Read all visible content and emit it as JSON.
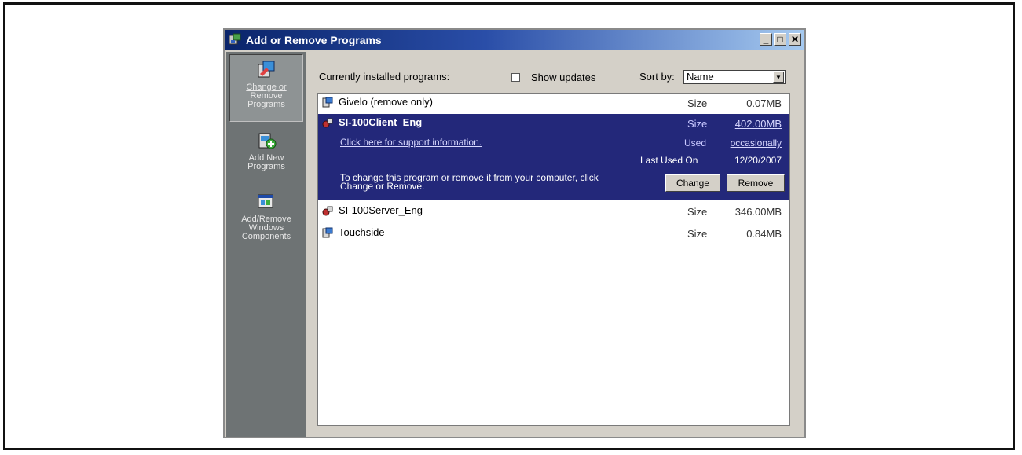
{
  "window": {
    "title": "Add or Remove Programs",
    "controls": {
      "minimize": "_",
      "maximize": "□",
      "close": "✕"
    }
  },
  "sidebar": {
    "items": [
      {
        "lines": [
          "Change or",
          "Remove",
          "Programs"
        ],
        "icon": "change-remove-icon",
        "active": true
      },
      {
        "lines": [
          "Add New",
          "Programs"
        ],
        "icon": "add-programs-icon",
        "active": false
      },
      {
        "lines": [
          "Add/Remove",
          "Windows",
          "Components"
        ],
        "icon": "windows-components-icon",
        "active": false
      }
    ]
  },
  "toolbar": {
    "installed_label": "Currently installed programs:",
    "show_updates_label": "Show updates",
    "show_updates_checked": false,
    "sort_label": "Sort by:",
    "sort_value": "Name"
  },
  "programs": [
    {
      "name": "Givelo (remove only)",
      "size_label": "Size",
      "size": "0.07MB",
      "icon": "installer-icon"
    },
    {
      "name": "SI-100Client_Eng",
      "size_label": "Size",
      "size": "402.00MB",
      "icon": "app-icon",
      "selected": true,
      "support_link": "Click here for support information.",
      "used_label": "Used",
      "used_value": "occasionally",
      "last_used_label": "Last Used On",
      "last_used_value": "12/20/2007",
      "description_line1": "To change this program or remove it from your computer, click",
      "description_line2": "Change or Remove.",
      "change_label": "Change",
      "remove_label": "Remove"
    },
    {
      "name": "SI-100Server_Eng",
      "size_label": "Size",
      "size": "346.00MB",
      "icon": "app-icon"
    },
    {
      "name": "Touchside",
      "size_label": "Size",
      "size": "0.84MB",
      "icon": "installer-icon"
    }
  ],
  "colors": {
    "titlebar_start": "#0a246a",
    "titlebar_end": "#a6caf0",
    "selection": "#23287a",
    "sidebar": "#6e7374"
  }
}
